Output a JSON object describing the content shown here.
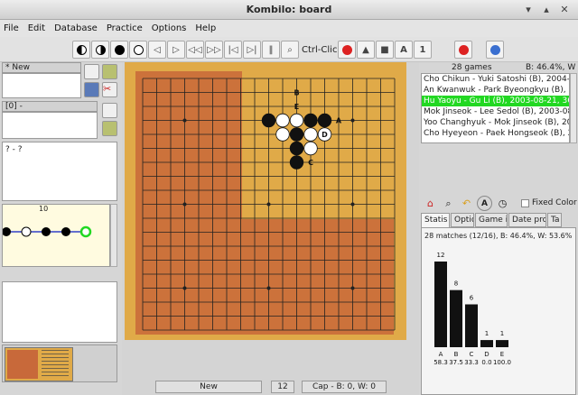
{
  "window": {
    "title": "Kombilo: board"
  },
  "menu": [
    "File",
    "Edit",
    "Database",
    "Practice",
    "Options",
    "Help"
  ],
  "toolbar": {
    "ctrl_click_label": "Ctrl-Click:",
    "a_label": "A",
    "one_label": "1"
  },
  "left": {
    "new_label": "* New",
    "zero_label": "[0]  -",
    "players_label": "? - ?",
    "move_number": "10"
  },
  "status": {
    "mode": "New",
    "move": "12",
    "captures": "Cap - B: 0, W: 0"
  },
  "right": {
    "games_count": "28 games",
    "percent_label": "B: 46.4%, W",
    "games": [
      "Cho Chikun - Yuki Satoshi (B), 2004-",
      "An Kwanwuk - Park Byeongkyu (B), 2",
      "Hu Yaoyu - Gu Li (B), 2003-08-21, 36",
      "Mok Jinseok - Lee Sedol (B), 2003-08",
      "Yoo Changhyuk - Mok Jinseok (B), 20",
      "Cho Hyeyeon - Paek Hongseok (B), 2"
    ],
    "selected_index": 2,
    "fixed_color_label": "Fixed Color",
    "tabs": [
      "Statis",
      "Optio",
      "Game i",
      "Date pro",
      "Ta"
    ],
    "stats_summary": "28 matches (12/16), B: 46.4%, W: 53.6%"
  },
  "chart_data": {
    "type": "bar",
    "categories": [
      "A",
      "B",
      "C",
      "D",
      "E"
    ],
    "values": [
      12,
      8,
      6,
      1,
      1
    ],
    "sub_labels": [
      "58.3",
      "37.5",
      "33.3",
      "0.0",
      "100.0"
    ],
    "title": "",
    "xlabel": "",
    "ylabel": "",
    "ylim": [
      0,
      12
    ]
  },
  "board": {
    "size": 19,
    "black_stones": [
      [
        9,
        3
      ],
      [
        12,
        3
      ],
      [
        13,
        3
      ],
      [
        11,
        4
      ],
      [
        11,
        5
      ],
      [
        12,
        5
      ],
      [
        11,
        6
      ]
    ],
    "white_stones": [
      [
        10,
        3
      ],
      [
        11,
        3
      ],
      [
        10,
        4
      ],
      [
        13,
        4
      ],
      [
        9,
        4
      ],
      [
        12,
        4
      ],
      [
        12,
        5.0
      ]
    ],
    "labels": [
      {
        "text": "B",
        "col": 11,
        "row": 1
      },
      {
        "text": "E",
        "col": 11,
        "row": 2
      },
      {
        "text": "A",
        "col": 14,
        "row": 3
      },
      {
        "text": "D",
        "col": 13,
        "row": 4
      },
      {
        "text": "C",
        "col": 12,
        "row": 6
      }
    ]
  },
  "colors": {
    "board_light": "#e0aa48",
    "board_region": "#c8693a",
    "selected_row": "#22d822",
    "bar": "#111111"
  }
}
